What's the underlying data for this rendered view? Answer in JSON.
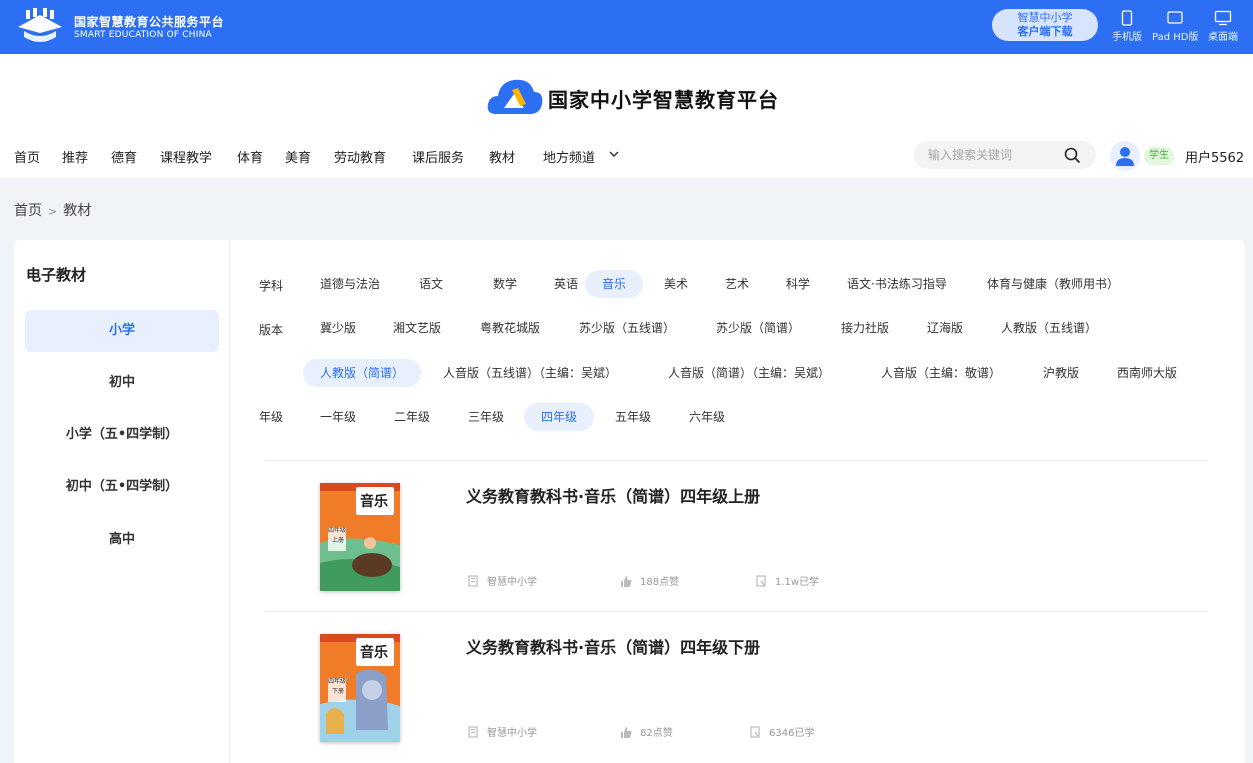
{
  "topbar": {
    "title": "国家智慧教育公共服务平台",
    "subtitle": "SMART EDUCATION OF CHINA",
    "client_line1": "智慧中小学",
    "client_line2": "客户端下载",
    "devices": [
      "手机版",
      "Pad HD版",
      "桌面端"
    ]
  },
  "header": {
    "title": "国家中小学智慧教育平台",
    "nav": [
      "首页",
      "推荐",
      "德育",
      "课程教学",
      "体育",
      "美育",
      "劳动教育",
      "课后服务",
      "教材",
      "地方频道"
    ],
    "search_placeholder": "输入搜索关键词",
    "role": "学生",
    "user": "用户5562"
  },
  "breadcrumb": [
    "首页",
    "教材"
  ],
  "sidebar": {
    "title": "电子教材",
    "items": [
      "小学",
      "初中",
      "小学（五•四学制）",
      "初中（五•四学制）",
      "高中"
    ],
    "active_index": 0
  },
  "filters": {
    "subject_label": "学科",
    "subjects": [
      "道德与法治",
      "语文",
      "数学",
      "英语",
      "音乐",
      "美术",
      "艺术",
      "科学",
      "语文·书法练习指导",
      "体育与健康（教师用书）"
    ],
    "subject_active": "音乐",
    "edition_label": "版本",
    "editions_row1": [
      "冀少版",
      "湘文艺版",
      "粤教花城版",
      "苏少版（五线谱）",
      "苏少版（简谱）",
      "接力社版",
      "辽海版",
      "人教版（五线谱）"
    ],
    "editions_row2": [
      "人教版（简谱）",
      "人音版（五线谱）（主编：吴斌）",
      "人音版（简谱）（主编：吴斌）",
      "人音版（主编：敬谱）",
      "沪教版",
      "西南师大版"
    ],
    "edition_active": "人教版（简谱）",
    "grade_label": "年级",
    "grades": [
      "一年级",
      "二年级",
      "三年级",
      "四年级",
      "五年级",
      "六年级"
    ],
    "grade_active": "四年级"
  },
  "books": [
    {
      "title": "义务教育教科书·音乐（简谱）四年级上册",
      "cover_title": "音乐",
      "cover_grade": "四年级",
      "cover_term": "上册",
      "publisher": "智慧中小学",
      "likes": "188点赞",
      "learners": "1.1w已学"
    },
    {
      "title": "义务教育教科书·音乐（简谱）四年级下册",
      "cover_title": "音乐",
      "cover_grade": "四年级",
      "cover_term": "下册",
      "publisher": "智慧中小学",
      "likes": "82点赞",
      "learners": "6346已学"
    }
  ],
  "colors": {
    "brand_blue": "#2d6ff2",
    "active_bg": "#e8f0fe",
    "student_green": "#4bb23a"
  }
}
